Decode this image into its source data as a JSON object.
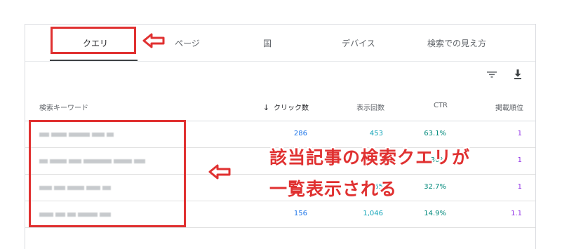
{
  "tabs": [
    {
      "label": "クエリ",
      "active": true
    },
    {
      "label": "ページ",
      "active": false
    },
    {
      "label": "国",
      "active": false
    },
    {
      "label": "デバイス",
      "active": false
    },
    {
      "label": "検索での見え方",
      "active": false
    }
  ],
  "toolbar": {
    "filter_icon": "filter-icon",
    "download_icon": "download-icon"
  },
  "table": {
    "headers": {
      "query": "検索キーワード",
      "clicks": "クリック数",
      "impressions": "表示回数",
      "ctr": "CTR",
      "position": "掲載順位"
    },
    "sort_indicator": "↓",
    "rows": [
      {
        "clicks": "286",
        "impressions": "453",
        "ctr": "63.1%",
        "position": "1"
      },
      {
        "clicks": "",
        "impressions": "54",
        "ctr": "36%",
        "position": "1"
      },
      {
        "clicks": "",
        "impressions": "65",
        "ctr": "32.7%",
        "position": "1"
      },
      {
        "clicks": "156",
        "impressions": "1,046",
        "ctr": "14.9%",
        "position": "1.1"
      }
    ]
  },
  "annotation": {
    "line1": "該当記事の検索クエリが",
    "line2": "一覧表示される"
  },
  "colors": {
    "annotation_red": "#e03131",
    "clicks": "#1a73e8",
    "impressions": "#12a4b8",
    "ctr": "#00897b",
    "position": "#9334e6"
  }
}
